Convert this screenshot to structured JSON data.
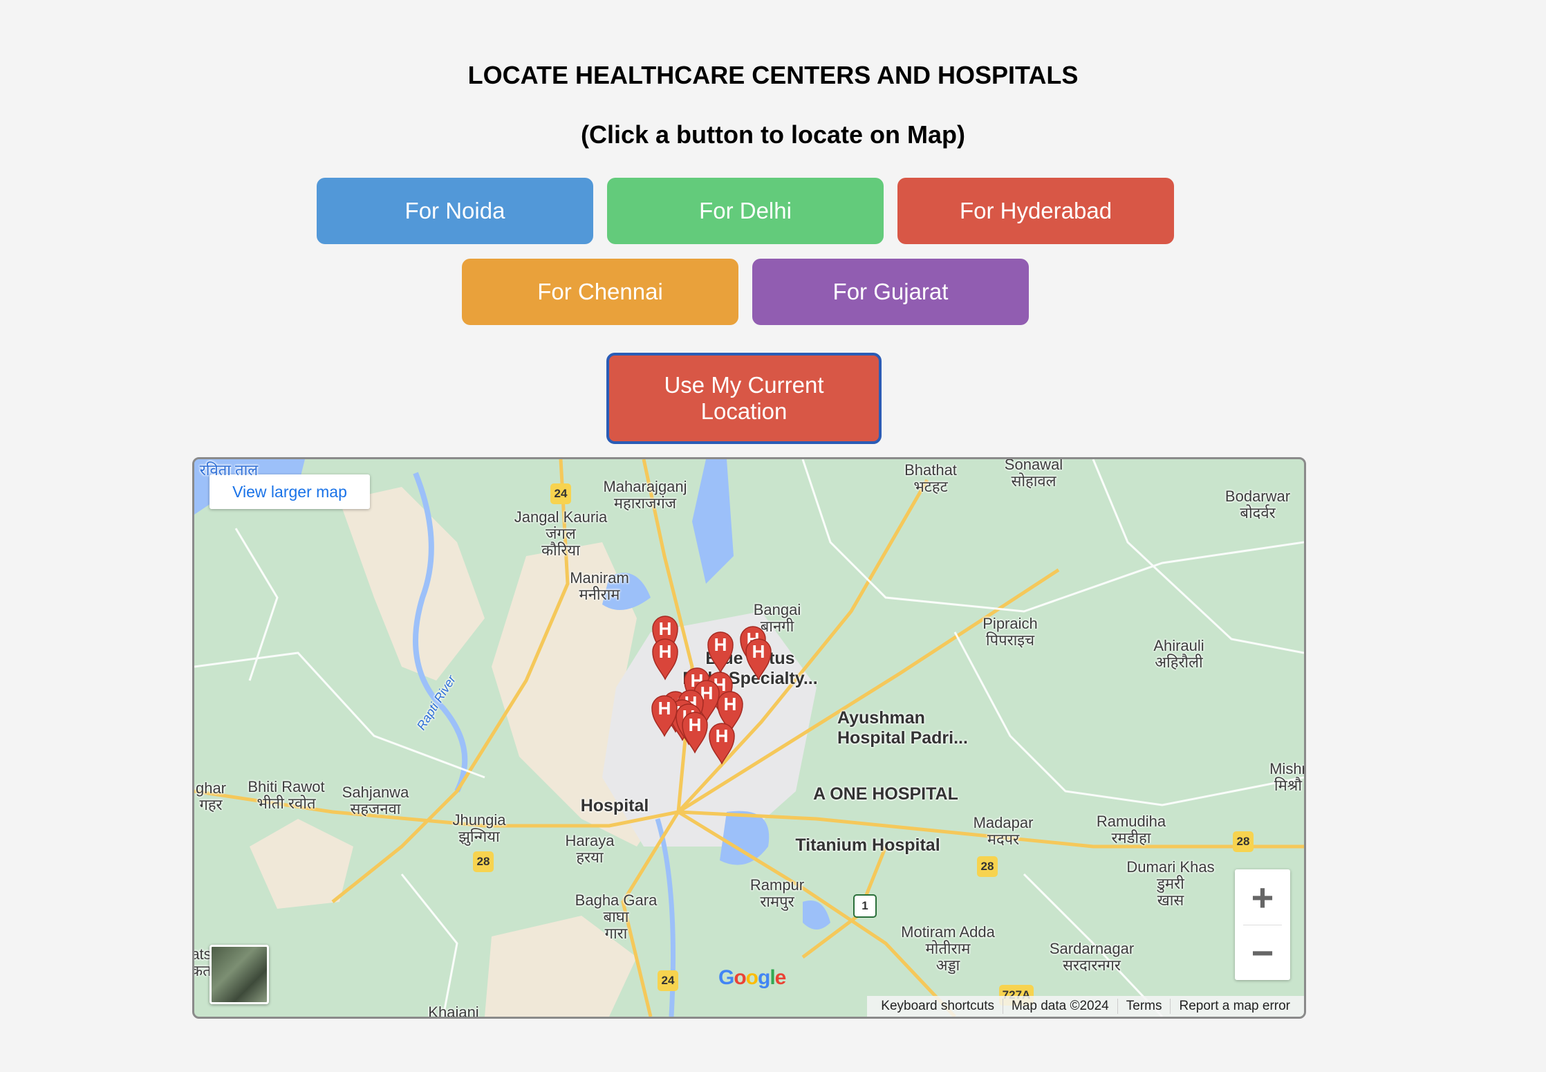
{
  "header": {
    "title": "LOCATE HEALTHCARE CENTERS AND HOSPITALS",
    "subtitle": "(Click a button to locate on Map)"
  },
  "buttons": {
    "noida": {
      "label": "For Noida",
      "color": "#5298d8"
    },
    "delhi": {
      "label": "For Delhi",
      "color": "#63cb7b"
    },
    "hyderabad": {
      "label": "For Hyderabad",
      "color": "#d85746"
    },
    "chennai": {
      "label": "For Chennai",
      "color": "#e9a13b"
    },
    "gujarat": {
      "label": "For Gujarat",
      "color": "#915db1"
    },
    "current_location": {
      "label": "Use My Current Location",
      "color": "#d85746"
    }
  },
  "map": {
    "view_larger": "View larger map",
    "labels": {
      "bhathat": "Bhathat\nभटहट",
      "sonawal": "Sonawal\nसोहावल",
      "bodarwar": "Bodarwar\nबोदर्वर",
      "maharajganj": "Maharajganj\nमहाराजगंज",
      "jangal_kauria": "Jangal Kauria\nजंगल\nकौरिया",
      "maniram": "Maniram\nमनीराम",
      "bangai": "Bangai\nबानगी",
      "pipraich": "Pipraich\nपिपराइच",
      "ahirauli": "Ahirauli\nअहिरौली",
      "blue_lotus": "Blue Lotus\nMulti-Specialty...",
      "ayushman": "Ayushman\nHospital Padri...",
      "a_one": "A ONE HOSPITAL",
      "hospital": "Hospital",
      "titanium": "Titanium Hospital",
      "mishr": "Mishr\nमिश्रौ",
      "ghar": "ghar\nगहर",
      "bhiti_rawot": "Bhiti Rawot\nभीती रवोत",
      "sahjanwa": "Sahjanwa\nसहजनवा",
      "jhungia": "Jhungia\nझुन्गिया",
      "haraya": "Haraya\nहरया",
      "madapar": "Madapar\nमदपर",
      "ramudiha": "Ramudiha\nरमडीहा",
      "dumari_khas": "Dumari Khas\nडुमरी\nखास",
      "rampur": "Rampur\nरामपुर",
      "bagha_gara": "Bagha Gara\nबाघा\nगारा",
      "motiram_adda": "Motiram Adda\nमोतीराम\nअड्डा",
      "sardarnagar": "Sardarnagar\nसरदारनगर",
      "khajani": "Khajani",
      "rapti_river": "Rapti River",
      "top_left": "रविता ताल",
      "ats": "ats\nकत"
    },
    "road_shields": [
      "24",
      "28",
      "28",
      "28",
      "1",
      "24",
      "727A"
    ],
    "zoom_in": "+",
    "zoom_out": "−",
    "google": "Google",
    "footer": {
      "keyboard": "Keyboard shortcuts",
      "map_data": "Map data ©2024",
      "terms": "Terms",
      "report": "Report a map error"
    },
    "marker_letter": "H",
    "marker_color": "#d9453a"
  }
}
